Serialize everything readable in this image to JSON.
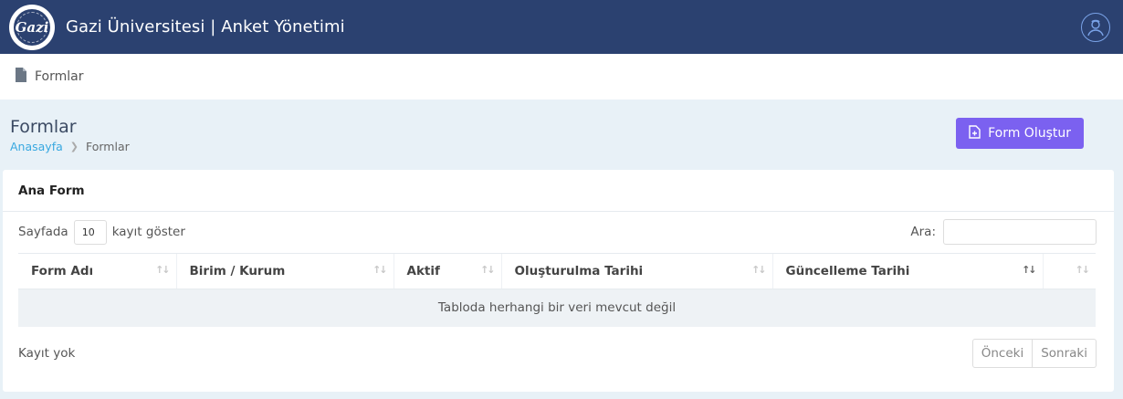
{
  "header": {
    "title": "Gazi Üniversitesi | Anket Yönetimi",
    "logo_text": "Gazi",
    "logo_icon": "university-seal-icon",
    "avatar_icon": "user-avatar-icon"
  },
  "subbar": {
    "icon": "document-icon",
    "label": "Formlar"
  },
  "page": {
    "title": "Formlar",
    "breadcrumb": [
      "Anasayfa",
      "Formlar"
    ],
    "create_button": "Form Oluştur"
  },
  "card": {
    "title": "Ana Form",
    "length_prefix": "Sayfada",
    "length_value": "10",
    "length_suffix": "kayıt göster",
    "search_label": "Ara:",
    "search_value": "",
    "columns": [
      "Form Adı",
      "Birim / Kurum",
      "Aktif",
      "Oluşturulma Tarihi",
      "Güncelleme Tarihi",
      ""
    ],
    "empty_message": "Tabloda herhangi bir veri mevcut değil",
    "info": "Kayıt yok",
    "prev": "Önceki",
    "next": "Sonraki"
  },
  "colors": {
    "topbar": "#2b4170",
    "primary_button": "#7b61f0",
    "link": "#38a8e0",
    "page_background": "#e8f1f7"
  }
}
